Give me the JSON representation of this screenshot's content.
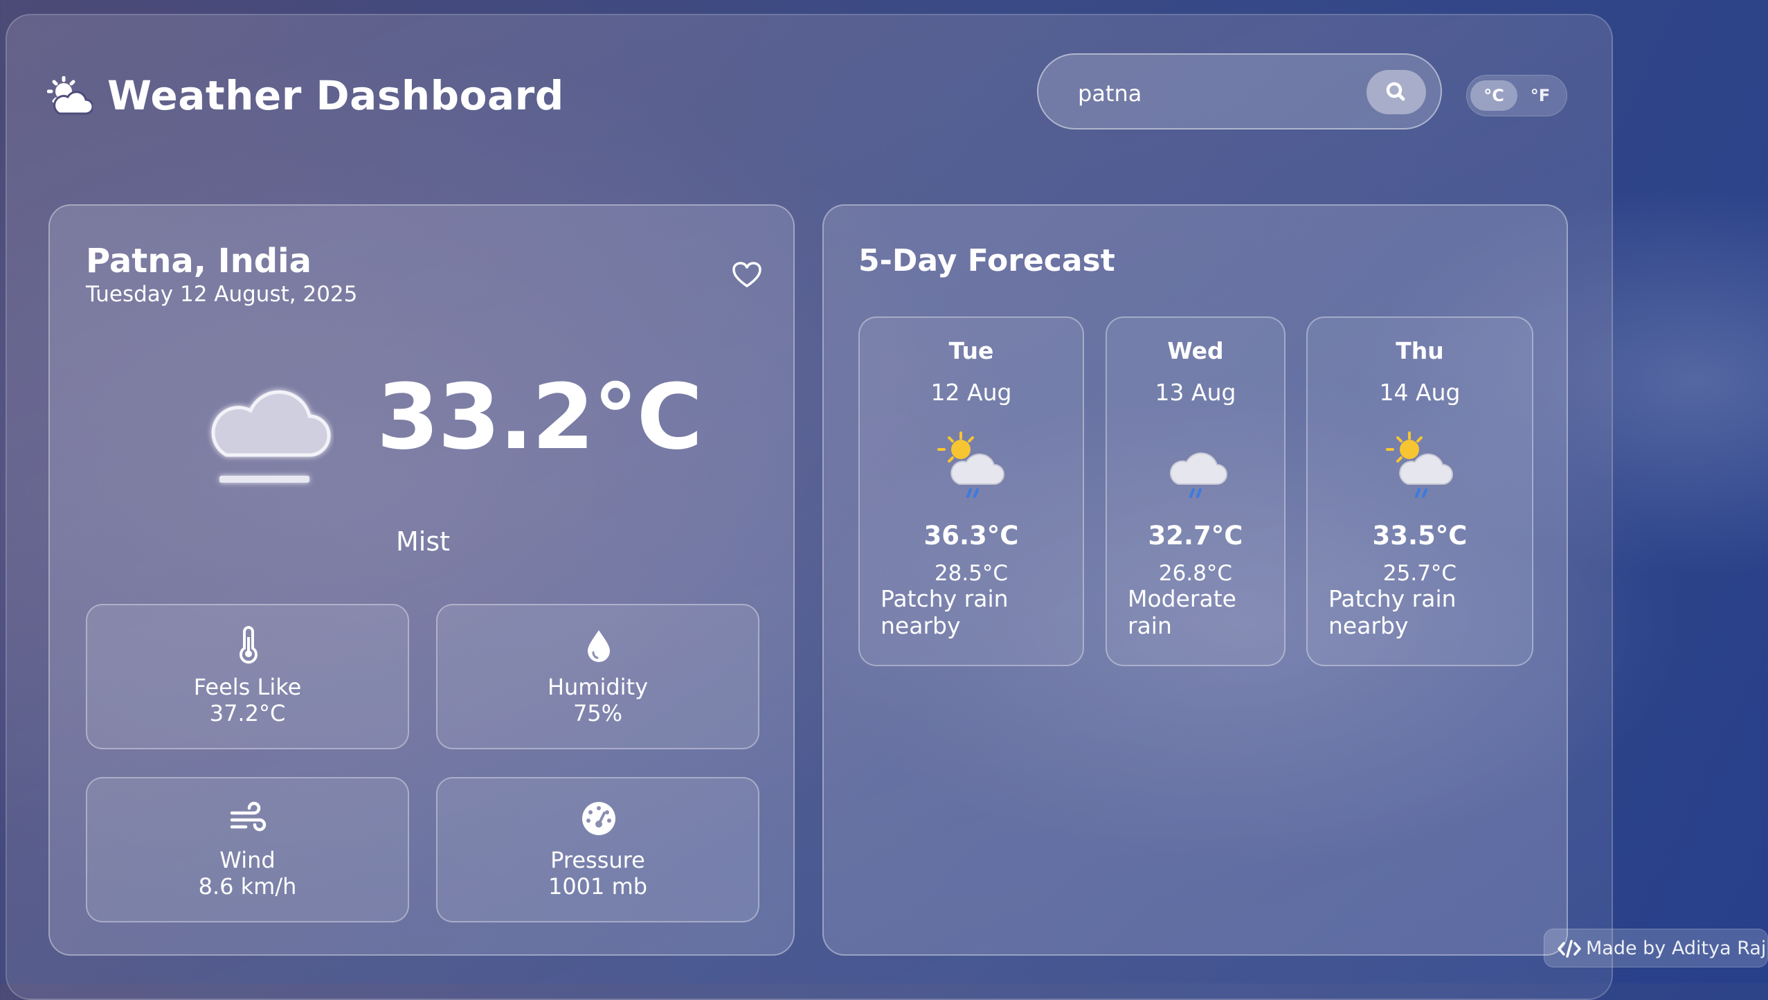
{
  "header": {
    "title": "Weather Dashboard",
    "logo_icon": "sun-cloud-icon"
  },
  "search": {
    "value": "patna",
    "placeholder": "",
    "button_icon": "search-icon"
  },
  "units": {
    "celsius_label": "°C",
    "fahrenheit_label": "°F",
    "selected": "°C"
  },
  "current": {
    "city": "Patna, India",
    "date": "Tuesday 12 August, 2025",
    "favorite_icon": "heart-outline-icon",
    "weather_icon": "mist-cloud-icon",
    "temperature": "33.2°C",
    "condition": "Mist",
    "stats": [
      {
        "label": "Feels Like",
        "value": "37.2°C",
        "icon": "thermometer-icon"
      },
      {
        "label": "Humidity",
        "value": "75%",
        "icon": "droplet-icon"
      },
      {
        "label": "Wind",
        "value": "8.6 km/h",
        "icon": "wind-icon"
      },
      {
        "label": "Pressure",
        "value": "1001 mb",
        "icon": "gauge-icon"
      }
    ]
  },
  "forecast": {
    "title": "5-Day Forecast",
    "days": [
      {
        "day": "Tue",
        "date": "12 Aug",
        "max": "36.3°C",
        "min": "28.5°C",
        "condition": "Patchy rain nearby",
        "icon": "sun-cloud-rain-icon"
      },
      {
        "day": "Wed",
        "date": "13 Aug",
        "max": "32.7°C",
        "min": "26.8°C",
        "condition": "Moderate rain",
        "icon": "cloud-rain-icon"
      },
      {
        "day": "Thu",
        "date": "14 Aug",
        "max": "33.5°C",
        "min": "25.7°C",
        "condition": "Patchy rain nearby",
        "icon": "sun-cloud-rain-icon"
      }
    ]
  },
  "footer": {
    "credit": "Made by Aditya Raj",
    "credit_icon": "code-icon"
  },
  "colors": {
    "background": "#3a4a86",
    "text": "#ffffff",
    "rain": "#3a7be0",
    "sun": "#f7c531"
  }
}
